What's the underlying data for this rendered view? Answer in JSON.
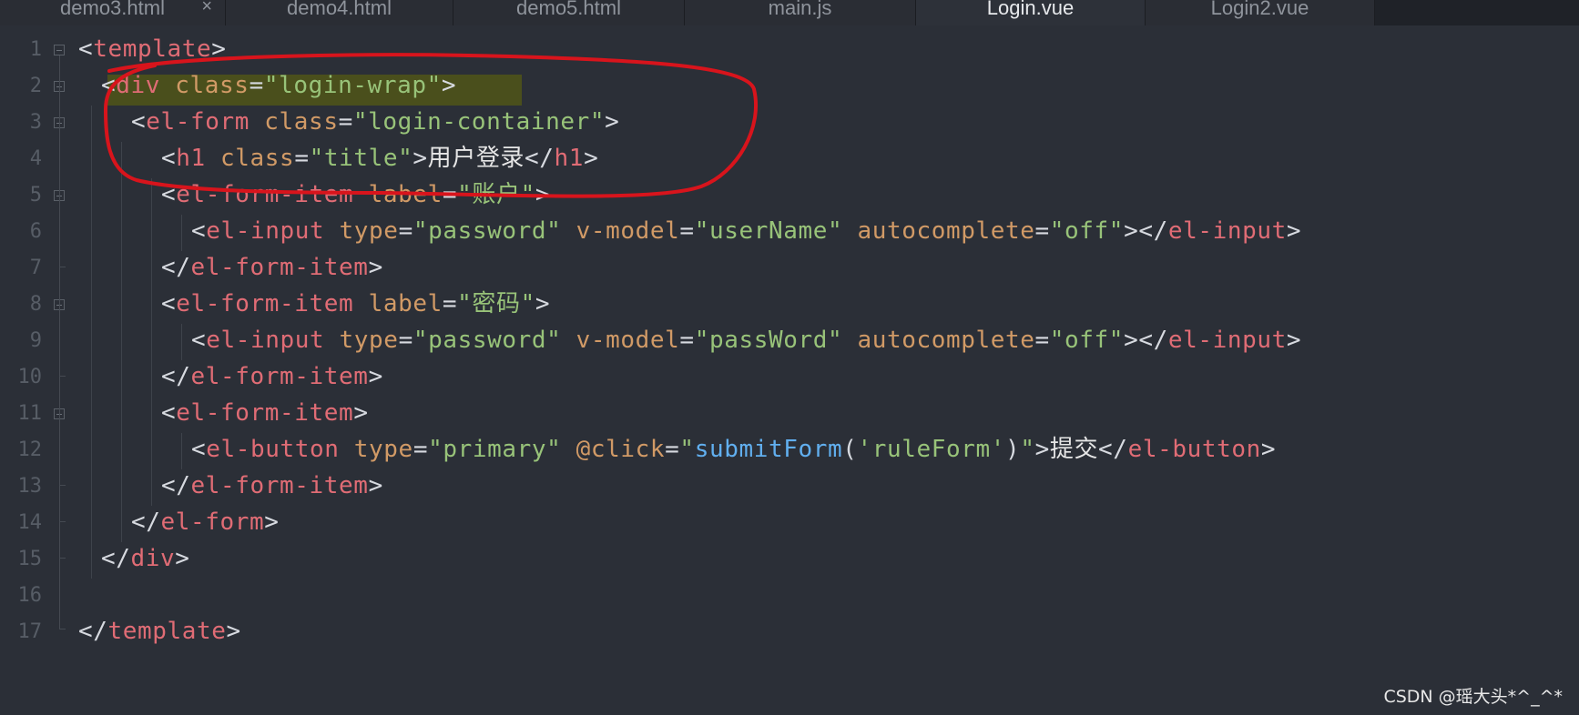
{
  "tabs": [
    {
      "label": "demo3.html",
      "active": false,
      "close": "×"
    },
    {
      "label": "demo4.html",
      "active": false
    },
    {
      "label": "demo5.html",
      "active": false
    },
    {
      "label": "main.js",
      "active": false
    },
    {
      "label": "Login.vue",
      "active": true
    },
    {
      "label": "Login2.vue",
      "active": false
    }
  ],
  "line_numbers": [
    "1",
    "2",
    "3",
    "4",
    "5",
    "6",
    "7",
    "8",
    "9",
    "10",
    "11",
    "12",
    "13",
    "14",
    "15",
    "16",
    "17"
  ],
  "code": {
    "l1": {
      "open": "<",
      "tag": "template",
      "close": ">"
    },
    "l2": {
      "open": "<",
      "tag": "div",
      "attr": " class",
      "eq": "=",
      "val": "\"login-wrap\"",
      "close": ">"
    },
    "l3": {
      "open": "<",
      "tag": "el-form",
      "attr": " class",
      "eq": "=",
      "val": "\"login-container\"",
      "close": ">"
    },
    "l4": {
      "open": "<",
      "tag": "h1",
      "attr": " class",
      "eq": "=",
      "val": "\"title\"",
      "close": ">",
      "text": "用户登录",
      "end_open": "</",
      "end_tag": "h1",
      "end_close": ">"
    },
    "l5": {
      "open": "<",
      "tag": "el-form-item",
      "attr": " label",
      "eq": "=",
      "val_q1": "\"",
      "val_cjk": "账户",
      "val_q2": "\"",
      "close": ">"
    },
    "l6": {
      "open": "<",
      "tag": "el-input",
      "a1": " type",
      "eq1": "=",
      "v1": "\"password\"",
      "a2": " v-model",
      "eq2": "=",
      "v2": "\"userName\"",
      "a3": " autocomplete",
      "eq3": "=",
      "v3": "\"off\"",
      "close": ">",
      "end_open": "</",
      "end_tag": "el-input",
      "end_close": ">"
    },
    "l7": {
      "end_open": "</",
      "end_tag": "el-form-item",
      "end_close": ">"
    },
    "l8": {
      "open": "<",
      "tag": "el-form-item",
      "attr": " label",
      "eq": "=",
      "val_q1": "\"",
      "val_cjk": "密码",
      "val_q2": "\"",
      "close": ">"
    },
    "l9": {
      "open": "<",
      "tag": "el-input",
      "a1": " type",
      "eq1": "=",
      "v1": "\"password\"",
      "a2": " v-model",
      "eq2": "=",
      "v2": "\"passWord\"",
      "a3": " autocomplete",
      "eq3": "=",
      "v3": "\"off\"",
      "close": ">",
      "end_open": "</",
      "end_tag": "el-input",
      "end_close": ">"
    },
    "l10": {
      "end_open": "</",
      "end_tag": "el-form-item",
      "end_close": ">"
    },
    "l11": {
      "open": "<",
      "tag": "el-form-item",
      "close": ">"
    },
    "l12": {
      "open": "<",
      "tag": "el-button",
      "a1": " type",
      "eq1": "=",
      "v1": "\"primary\"",
      "a2": " @click",
      "eq2": "=",
      "q1": "\"",
      "fn": "submitForm",
      "paren": "(",
      "arg": "'ruleForm'",
      "paren2": ")",
      "q2": "\"",
      "close": ">",
      "text": "提交",
      "end_open": "</",
      "end_tag": "el-button",
      "end_close": ">"
    },
    "l13": {
      "end_open": "</",
      "end_tag": "el-form-item",
      "end_close": ">"
    },
    "l14": {
      "end_open": "</",
      "end_tag": "el-form",
      "end_close": ">"
    },
    "l15": {
      "end_open": "</",
      "end_tag": "div",
      "end_close": ">"
    },
    "l16": {},
    "l17": {
      "end_open": "</",
      "end_tag": "template",
      "end_close": ">"
    }
  },
  "colors": {
    "background": "#2b2f37",
    "tag": "#e06c75",
    "attribute": "#d19a66",
    "string": "#98c379",
    "function": "#61afef",
    "annotation": "#d8141c",
    "highlight": "#4a4f1c"
  },
  "watermark": "CSDN @瑶大头*^_^*"
}
